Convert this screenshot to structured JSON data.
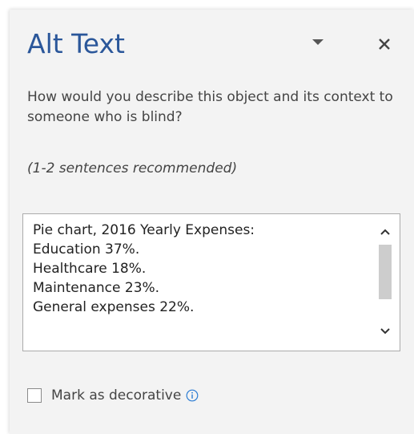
{
  "pane": {
    "title": "Alt Text",
    "question": "How would you describe this object and its context to someone who is blind?",
    "hint": "(1-2 sentences recommended)",
    "description_lines": [
      "Pie chart, 2016 Yearly Expenses:",
      "Education 37%.",
      "Healthcare 18%.",
      "Maintenance 23%.",
      "General expenses 22%."
    ],
    "decorative_label": "Mark as decorative",
    "decorative_checked": false
  },
  "icons": {
    "menu": "chevron-down-icon",
    "close": "close-icon",
    "scroll_up": "chevron-up-icon",
    "scroll_down": "chevron-down-icon",
    "info": "info-icon"
  },
  "colors": {
    "title": "#2b579a",
    "info": "#2b7cd3",
    "pane_background": "#f3f3f3"
  }
}
